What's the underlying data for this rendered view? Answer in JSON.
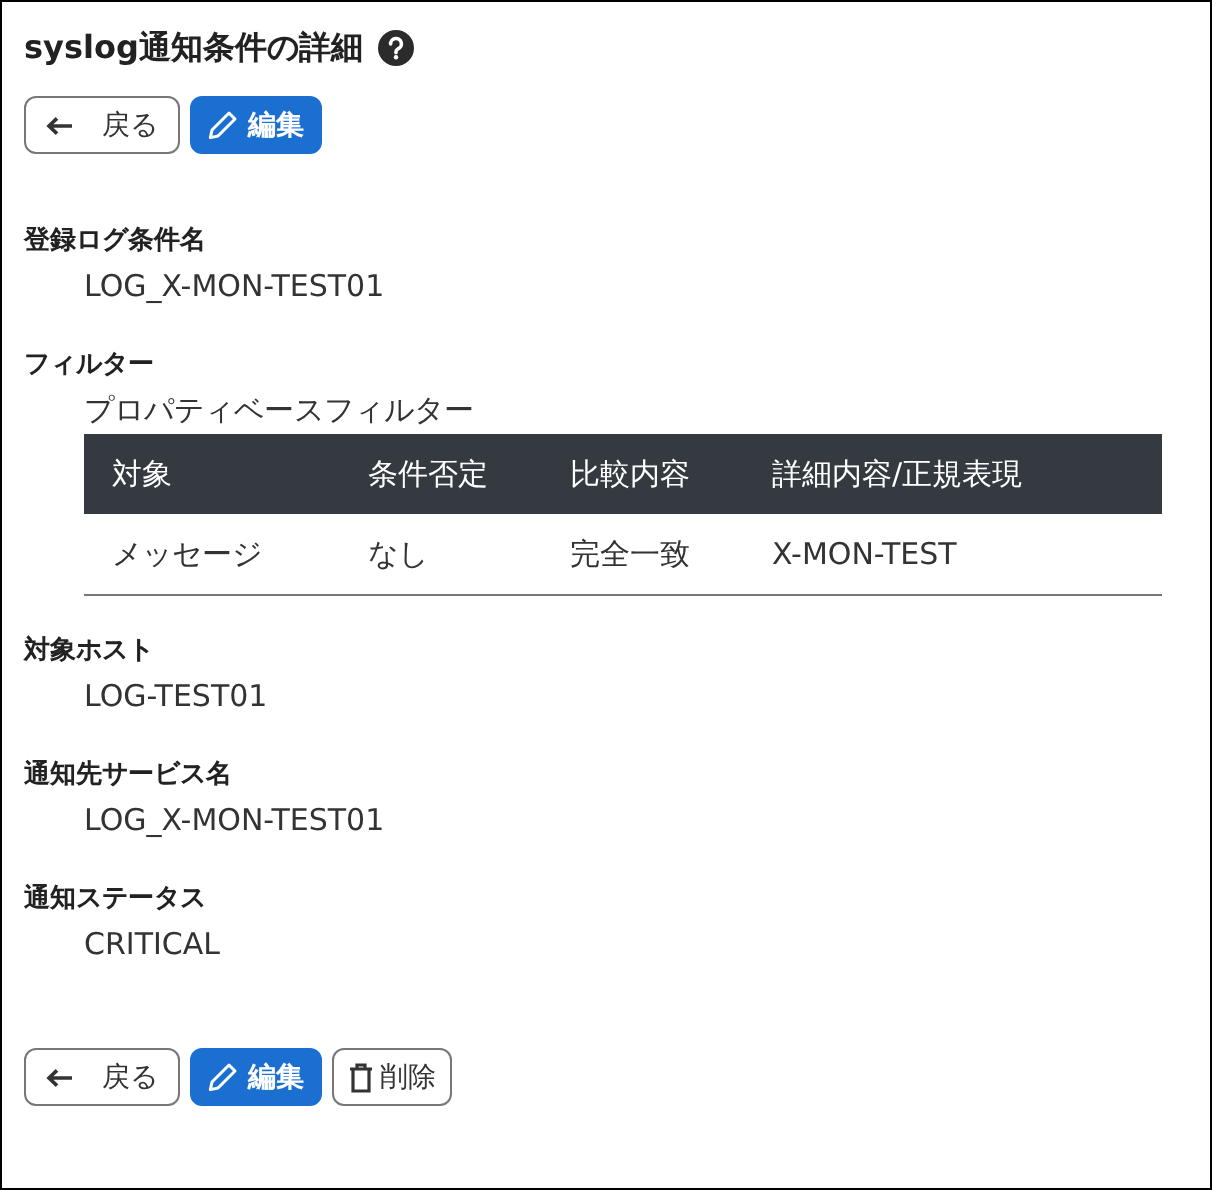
{
  "title": "syslog通知条件の詳細",
  "top_buttons": [
    {
      "kind": "back",
      "label": "戻る"
    },
    {
      "kind": "edit",
      "label": "編集"
    }
  ],
  "fields": [
    {
      "kind": "text",
      "label": "登録ログ条件名",
      "value": "LOG_X-MON-TEST01"
    },
    {
      "kind": "table",
      "label": "フィルター",
      "subtitle": "プロパティベースフィルター",
      "columns": [
        "対象",
        "条件否定",
        "比較内容",
        "詳細内容/正規表現"
      ],
      "rows": [
        [
          "メッセージ",
          "なし",
          "完全一致",
          "X-MON-TEST"
        ]
      ]
    },
    {
      "kind": "text",
      "label": "対象ホスト",
      "value": "LOG-TEST01"
    },
    {
      "kind": "text",
      "label": "通知先サービス名",
      "value": "LOG_X-MON-TEST01"
    },
    {
      "kind": "text",
      "label": "通知ステータス",
      "value": "CRITICAL"
    }
  ],
  "bottom_buttons": [
    {
      "kind": "back",
      "label": "戻る"
    },
    {
      "kind": "edit",
      "label": "編集"
    },
    {
      "kind": "delete",
      "label": "削除"
    }
  ]
}
